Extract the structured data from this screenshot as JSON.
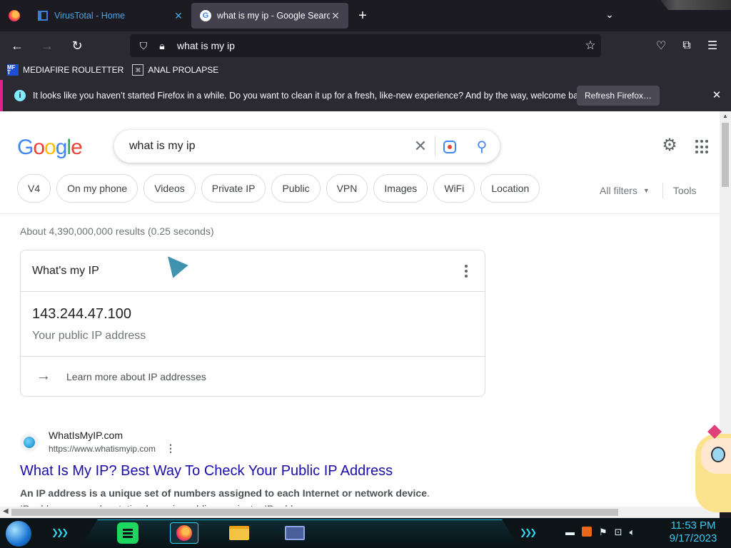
{
  "browser": {
    "tabs": [
      {
        "title": "VirusTotal - Home",
        "active": false,
        "icon": "virustotal-icon"
      },
      {
        "title": "what is my ip - Google Search",
        "active": true,
        "icon": "google-icon"
      }
    ],
    "url": "what is my ip",
    "bookmarks": [
      {
        "label": "MEDIAFIRE ROULETTER",
        "icon_text": "MF T"
      },
      {
        "label": "ANAL PROLAPSE",
        "icon_text": "⌘"
      }
    ],
    "notification": {
      "message": "It looks like you haven’t started Firefox in a while. Do you want to clean it up for a fresh, like-new experience? And by the way, welcome back!",
      "button": "Refresh Firefox…"
    }
  },
  "google": {
    "logo": [
      "G",
      "o",
      "o",
      "g",
      "l",
      "e"
    ],
    "query": "what is my ip",
    "chips": [
      "V4",
      "On my phone",
      "Videos",
      "Private IP",
      "Public",
      "VPN",
      "Images",
      "WiFi",
      "Location"
    ],
    "all_filters": "All filters",
    "tools": "Tools",
    "stats": "About 4,390,000,000 results (0.25 seconds)",
    "ip_card": {
      "title": "What's my IP",
      "ip": "143.244.47.100",
      "subtitle": "Your public IP address",
      "learn_more": "Learn more about IP addresses"
    },
    "result": {
      "site_name": "WhatIsMyIP.com",
      "site_url": "https://www.whatismyip.com",
      "title": "What Is My IP? Best Way To Check Your Public IP Address",
      "snippet_bold": "An IP address is a unique set of numbers assigned to each Internet or network device",
      "snippet_rest": ". IP addresses can be static, dynamic, public, or private. IP addresses ..."
    }
  },
  "taskbar": {
    "time": "11:53 PM",
    "date": "9/17/2023"
  },
  "colors": {
    "link": "#1a0dab",
    "notice_accent": "#e0238b",
    "clock": "#3ec6ef"
  }
}
